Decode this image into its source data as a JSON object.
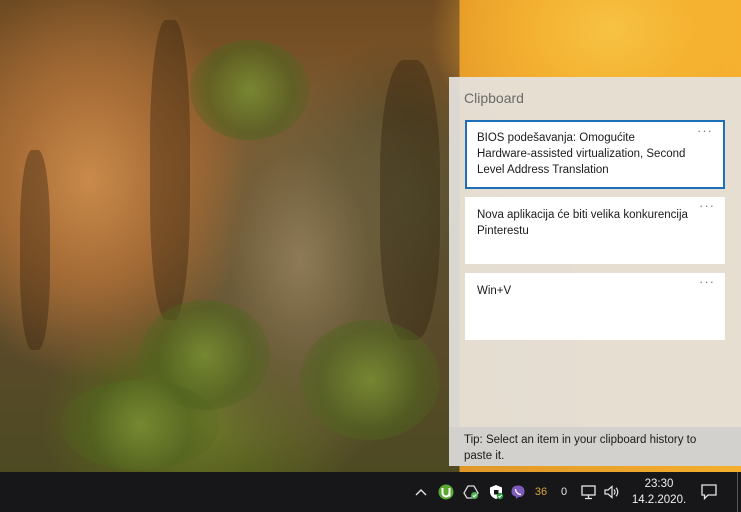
{
  "clipboard": {
    "title": "Clipboard",
    "items": [
      {
        "text": "BIOS podešavanja: Omogućite Hardware-assisted virtualization, Second Level Address Translation",
        "more": "···",
        "selected": true
      },
      {
        "text": "Nova aplikacija će biti velika konkurencija Pinterestu",
        "more": "···",
        "selected": false
      },
      {
        "text": "Win+V",
        "more": "···",
        "selected": false
      }
    ],
    "tip": "Tip: Select an item in your clipboard history to paste it."
  },
  "taskbar": {
    "tray": {
      "chevron_icon": "chevron-up-icon",
      "badge_36": "36",
      "badge_0": "0"
    },
    "clock": {
      "time": "23:30",
      "date": "14.2.2020."
    }
  },
  "colors": {
    "selection_border": "#1d6fb8",
    "taskbar_bg": "#17171a",
    "utorrent_green": "#5aa832",
    "viber_purple": "#7d5bbd",
    "badge_36": "#d7a63b"
  }
}
